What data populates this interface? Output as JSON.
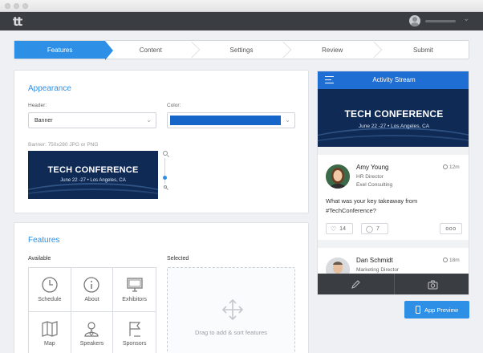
{
  "app": {
    "logo_text": "tt"
  },
  "steps": [
    {
      "label": "Features",
      "active": true
    },
    {
      "label": "Content",
      "active": false
    },
    {
      "label": "Settings",
      "active": false
    },
    {
      "label": "Review",
      "active": false
    },
    {
      "label": "Submit",
      "active": false
    }
  ],
  "appearance": {
    "title": "Appearance",
    "header_label": "Header:",
    "header_value": "Banner",
    "color_label": "Color:",
    "color_value": "#1665c8",
    "banner_hint": "Banner: 750x280 JPG or PNG",
    "zoom_level": 0.75
  },
  "banner": {
    "title": "TECH CONFERENCE",
    "subtitle": "June 22 -27  •  Los Angeles, CA"
  },
  "features": {
    "title": "Features",
    "available_label": "Available",
    "selected_label": "Selected",
    "tiles": [
      {
        "label": "Schedule",
        "icon": "clock-icon"
      },
      {
        "label": "About",
        "icon": "info-icon"
      },
      {
        "label": "Exhibitors",
        "icon": "monitor-icon"
      },
      {
        "label": "Map",
        "icon": "map-icon"
      },
      {
        "label": "Speakers",
        "icon": "speaker-icon"
      },
      {
        "label": "Sponsors",
        "icon": "flag-icon"
      }
    ],
    "drop_hint": "Drag to add & sort features"
  },
  "phone": {
    "title": "Activity Stream",
    "posts": [
      {
        "name": "Amy Young",
        "role": "HR Director",
        "company": "Exel Consulting",
        "time": "12m",
        "body": "What was your key takeaway from #TechConference?",
        "likes": "14",
        "comments": "7",
        "more": "ooo"
      },
      {
        "name": "Dan Schmidt",
        "role": "Marketing Director",
        "time": "18m"
      }
    ]
  },
  "preview_button": {
    "label": "App Preview"
  },
  "colors": {
    "accent": "#2d8fe6",
    "topbar": "#3a3d42",
    "banner_bg": "#0f2a55"
  }
}
